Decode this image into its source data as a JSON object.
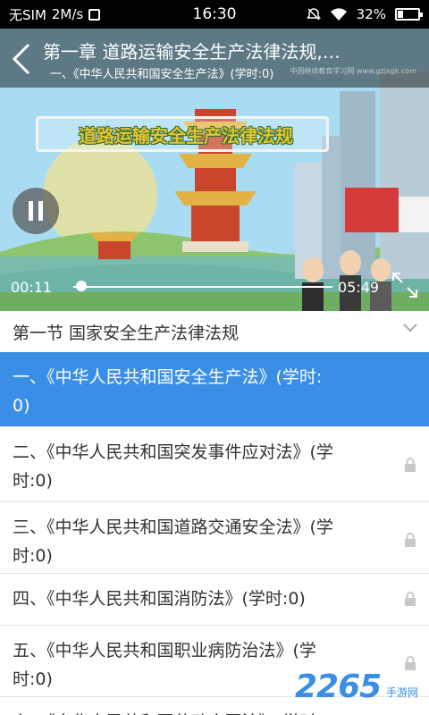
{
  "status_bar": {
    "carrier": "无SIM",
    "speed": "2M/s",
    "time": "16:30",
    "battery": "32%"
  },
  "video": {
    "title": "第一章 道路运输安全生产法律法规,…",
    "subtitle": "一、《中华人民共和国安全生产法》(学时:0)",
    "watermark": "中国继续教育学习网 www.gzjxgk.com",
    "banner_text": "道路运输安全生产法律法规",
    "current_time": "00:11",
    "duration": "05:49",
    "progress": 0.03
  },
  "section": {
    "title": "第一节 国家安全生产法律法规"
  },
  "lessons": [
    {
      "line1": "一、《中华人民共和国安全生产法》(学时:",
      "line2": "0)",
      "locked": false,
      "active": true
    },
    {
      "line1": "二、《中华人民共和国突发事件应对法》(学",
      "line2": "时:0)",
      "locked": true,
      "active": false
    },
    {
      "line1": "三、《中华人民共和国道路交通安全法》(学",
      "line2": "时:0)",
      "locked": true,
      "active": false
    },
    {
      "line1": "四、《中华人民共和国消防法》(学时:0)",
      "line2": "",
      "locked": true,
      "active": false
    },
    {
      "line1": "五、《中华人民共和国职业病防治法》(学",
      "line2": "时:0)",
      "locked": true,
      "active": false
    },
    {
      "line1": "六、《中华人民共和国劳动合同法》(学时",
      "line2": "",
      "locked": true,
      "active": false
    }
  ],
  "watermark": {
    "logo": "2265",
    "site": "手游网"
  },
  "colors": {
    "accent": "#3a8ee6",
    "lock": "#c8c8c8"
  }
}
